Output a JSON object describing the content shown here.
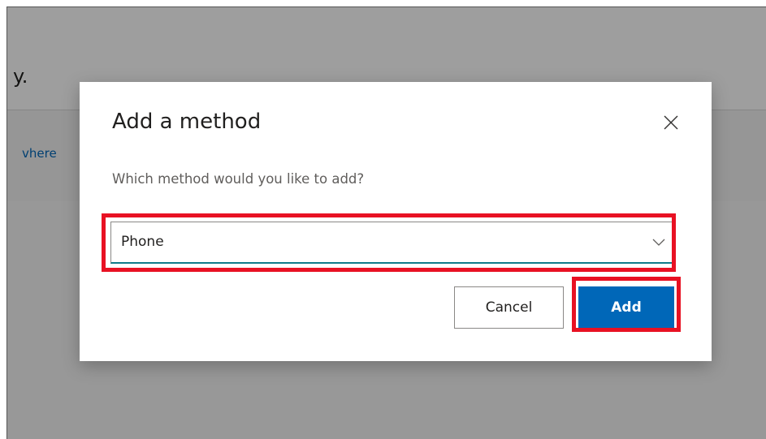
{
  "background": {
    "heading_fragment": "y.",
    "link_fragment": "vhere",
    "link_color": "#0067b8"
  },
  "dialog": {
    "title": "Add a method",
    "close_icon": "close-icon",
    "prompt": "Which method would you like to add?",
    "method_select": {
      "value": "Phone",
      "chevron_icon": "chevron-down-icon"
    },
    "buttons": {
      "cancel_label": "Cancel",
      "add_label": "Add"
    }
  },
  "colors": {
    "primary": "#0067b8",
    "highlight": "#e81123",
    "focus_underline": "#0f7b8a"
  }
}
